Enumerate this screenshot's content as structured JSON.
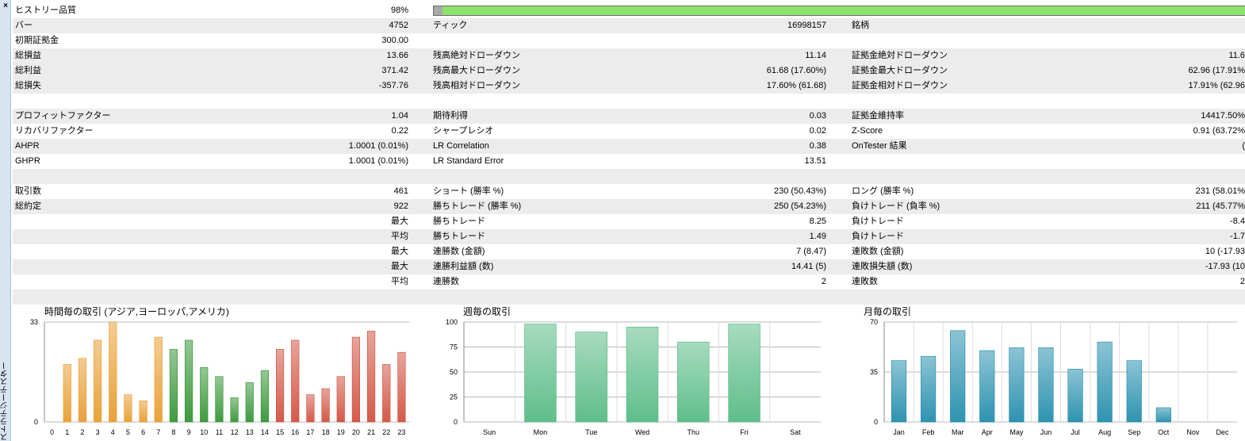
{
  "window": {
    "title": "ストラテジーテスター",
    "close_glyph": "×"
  },
  "history_quality": {
    "label": "ヒストリー品質",
    "value": "98%",
    "fraction": 0.98
  },
  "rows": [
    {
      "shade": true,
      "l1": "バー",
      "v1": "4752",
      "l2": "ティック",
      "v2": "16998157",
      "l3": "銘柄",
      "v3": ""
    },
    {
      "shade": false,
      "l1": "初期証拠金",
      "v1": "300.00",
      "l2": "",
      "v2": "",
      "l3": "",
      "v3": ""
    },
    {
      "shade": true,
      "l1": "総損益",
      "v1": "13.66",
      "l2": "残高絶対ドローダウン",
      "v2": "11.14",
      "l3": "証拠金絶対ドローダウン",
      "v3": "11.6"
    },
    {
      "shade": true,
      "l1": "総利益",
      "v1": "371.42",
      "l2": "残高最大ドローダウン",
      "v2": "61.68 (17.60%)",
      "l3": "証拠金最大ドローダウン",
      "v3": "62.96 (17.91%"
    },
    {
      "shade": true,
      "l1": "総損失",
      "v1": "-357.76",
      "l2": "残高相対ドローダウン",
      "v2": "17.60% (61.68)",
      "l3": "証拠金相対ドローダウン",
      "v3": "17.91% (62.96"
    },
    {
      "shade": false,
      "l1": "",
      "v1": "",
      "l2": "",
      "v2": "",
      "l3": "",
      "v3": ""
    },
    {
      "shade": true,
      "l1": "プロフィットファクター",
      "v1": "1.04",
      "l2": "期待利得",
      "v2": "0.03",
      "l3": "証拠金維持率",
      "v3": "14417.50%"
    },
    {
      "shade": false,
      "l1": "リカバリファクター",
      "v1": "0.22",
      "l2": "シャープレシオ",
      "v2": "0.02",
      "l3": "Z-Score",
      "v3": "0.91 (63.72%"
    },
    {
      "shade": true,
      "l1": "AHPR",
      "v1": "1.0001 (0.01%)",
      "l2": "LR Correlation",
      "v2": "0.38",
      "l3": "OnTester 結果",
      "v3": "("
    },
    {
      "shade": false,
      "l1": "GHPR",
      "v1": "1.0001 (0.01%)",
      "l2": "LR Standard Error",
      "v2": "13.51",
      "l3": "",
      "v3": ""
    },
    {
      "shade": true,
      "l1": "",
      "v1": "",
      "l2": "",
      "v2": "",
      "l3": "",
      "v3": ""
    },
    {
      "shade": false,
      "l1": "取引数",
      "v1": "461",
      "l2": "ショート (勝率 %)",
      "v2": "230 (50.43%)",
      "l3": "ロング (勝率 %)",
      "v3": "231 (58.01%"
    },
    {
      "shade": true,
      "l1": "総約定",
      "v1": "922",
      "l2": "勝ちトレード (勝率 %)",
      "v2": "250 (54.23%)",
      "l3": "負けトレード (負率 %)",
      "v3": "211 (45.77%"
    },
    {
      "shade": false,
      "l1": "",
      "v1": "最大",
      "l2": "勝ちトレード",
      "v2": "8.25",
      "l3": "負けトレード",
      "v3": "-8.4"
    },
    {
      "shade": true,
      "l1": "",
      "v1": "平均",
      "l2": "勝ちトレード",
      "v2": "1.49",
      "l3": "負けトレード",
      "v3": "-1.7"
    },
    {
      "shade": false,
      "l1": "",
      "v1": "最大",
      "l2": "連勝数 (金額)",
      "v2": "7 (8.47)",
      "l3": "連敗数 (金額)",
      "v3": "10 (-17.93"
    },
    {
      "shade": true,
      "l1": "",
      "v1": "最大",
      "l2": "連勝利益額 (数)",
      "v2": "14.41 (5)",
      "l3": "連敗損失額 (数)",
      "v3": "-17.93 (10"
    },
    {
      "shade": false,
      "l1": "",
      "v1": "平均",
      "l2": "連勝数",
      "v2": "2",
      "l3": "連敗数",
      "v3": "2"
    },
    {
      "shade": true,
      "l1": "",
      "v1": "",
      "l2": "",
      "v2": "",
      "l3": "",
      "v3": ""
    }
  ],
  "chart_data": [
    {
      "type": "bar",
      "title": "時間毎の取引 (アジア,ヨーロッパ,アメリカ)",
      "categories": [
        "0",
        "1",
        "2",
        "3",
        "4",
        "5",
        "6",
        "7",
        "8",
        "9",
        "10",
        "11",
        "12",
        "13",
        "14",
        "15",
        "16",
        "17",
        "18",
        "19",
        "20",
        "21",
        "22",
        "23"
      ],
      "values": [
        0,
        19,
        21,
        27,
        33,
        9,
        7,
        28,
        24,
        27,
        18,
        15,
        8,
        13,
        17,
        24,
        27,
        9,
        11,
        15,
        28,
        30,
        19,
        23
      ],
      "ylim": [
        0,
        33
      ],
      "yticks": [
        0,
        33
      ],
      "colors": [
        "#e9a23b",
        "#e9a23b",
        "#e9a23b",
        "#e9a23b",
        "#e9a23b",
        "#e9a23b",
        "#e9a23b",
        "#e9a23b",
        "#3f9a3f",
        "#3f9a3f",
        "#3f9a3f",
        "#3f9a3f",
        "#3f9a3f",
        "#3f9a3f",
        "#3f9a3f",
        "#d45a4a",
        "#d45a4a",
        "#d45a4a",
        "#d45a4a",
        "#d45a4a",
        "#d45a4a",
        "#d45a4a",
        "#d45a4a",
        "#d45a4a"
      ],
      "grid": true
    },
    {
      "type": "bar",
      "title": "週毎の取引",
      "categories": [
        "Sun",
        "Mon",
        "Tue",
        "Wed",
        "Thu",
        "Fri",
        "Sat"
      ],
      "values": [
        0,
        98,
        90,
        95,
        80,
        98,
        0
      ],
      "ylim": [
        0,
        100
      ],
      "yticks": [
        0,
        25,
        50,
        75,
        100
      ],
      "colors": [
        "#5fbe8a",
        "#5fbe8a",
        "#5fbe8a",
        "#5fbe8a",
        "#5fbe8a",
        "#5fbe8a",
        "#5fbe8a"
      ],
      "grid": true
    },
    {
      "type": "bar",
      "title": "月毎の取引",
      "categories": [
        "Jan",
        "Feb",
        "Mar",
        "Apr",
        "May",
        "Jun",
        "Jul",
        "Aug",
        "Sep",
        "Oct",
        "Nov",
        "Dec"
      ],
      "values": [
        43,
        46,
        64,
        50,
        52,
        52,
        37,
        56,
        43,
        10,
        0,
        0
      ],
      "ylim": [
        0,
        70
      ],
      "yticks": [
        0,
        35,
        70
      ],
      "colors": [
        "#2e93b0",
        "#2e93b0",
        "#2e93b0",
        "#2e93b0",
        "#2e93b0",
        "#2e93b0",
        "#2e93b0",
        "#2e93b0",
        "#2e93b0",
        "#2e93b0",
        "#2e93b0",
        "#2e93b0"
      ],
      "grid": true
    }
  ]
}
